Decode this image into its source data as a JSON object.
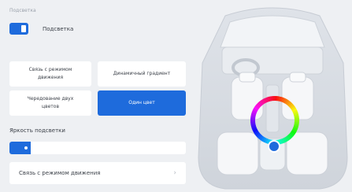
{
  "section": {
    "title": "Подсветка"
  },
  "toggle": {
    "label": "Подсветка",
    "on": true
  },
  "modes": [
    {
      "label": "Связь с режимом движения",
      "selected": false
    },
    {
      "label": "Динамичный градиент",
      "selected": false
    },
    {
      "label": "Чередование двух цветов",
      "selected": false
    },
    {
      "label": "Один цвет",
      "selected": true
    }
  ],
  "brightness": {
    "label": "Яркость подсветки",
    "value_percent": 12
  },
  "link": {
    "label": "Связь с режимом движения",
    "icon": "chevron-right-icon"
  },
  "colors": {
    "accent": "#1e6bdc",
    "background": "#eef0f3",
    "card": "#ffffff",
    "picker_selected": "#1e6bdc"
  }
}
